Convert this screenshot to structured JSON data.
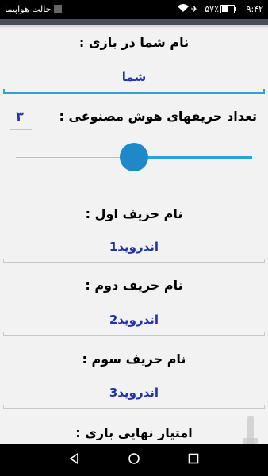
{
  "status": {
    "time": "۹:۴۲",
    "battery_percent": "۵۷٪",
    "battery_level": 0.57,
    "airplane_mode": "حالت هواپیما"
  },
  "form": {
    "player_name_label": "نام شما در بازی :",
    "player_name_value": "شما",
    "ai_count_label": "تعداد حریفهای هوش مصنوعی :",
    "ai_count_value": "۳",
    "ai_slider_fraction": 0.45,
    "opponent1_label": "نام حریف اول :",
    "opponent1_value": "اندروید1",
    "opponent2_label": "نام حریف دوم :",
    "opponent2_value": "اندروید2",
    "opponent3_label": "نام حریف سوم :",
    "opponent3_value": "اندروید3",
    "final_score_label": "امتیاز نهایی بازی :"
  },
  "icons": {
    "back": "back-triangle-icon",
    "home": "home-circle-icon",
    "recent": "recent-square-icon"
  },
  "colors": {
    "accent": "#2aa3d8",
    "slider_thumb": "#1f88c9",
    "value_text": "#2233aa"
  }
}
